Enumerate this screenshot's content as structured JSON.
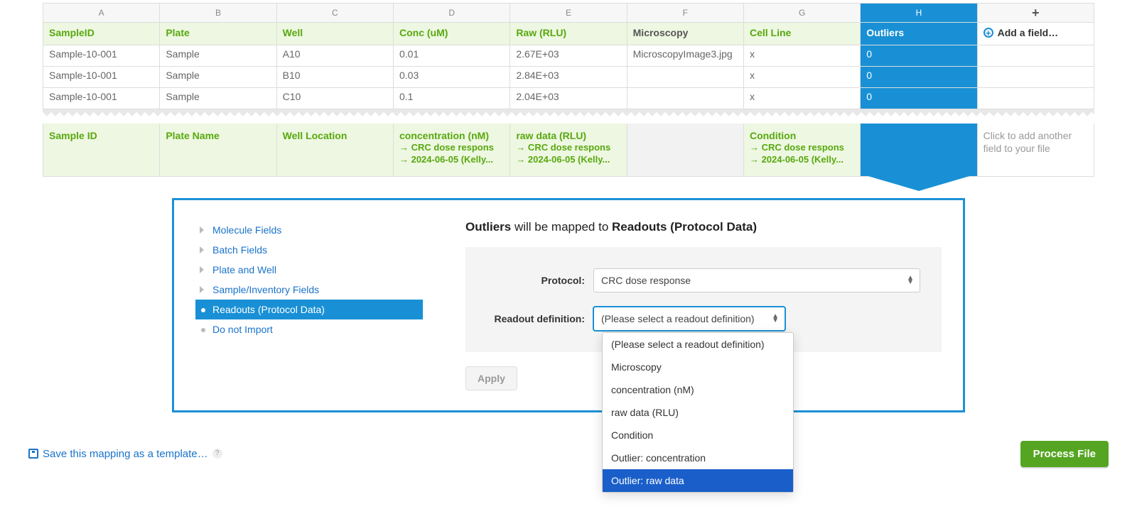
{
  "columns": {
    "letters": [
      "A",
      "B",
      "C",
      "D",
      "E",
      "F",
      "G",
      "H",
      "+"
    ],
    "headers": [
      "SampleID",
      "Plate",
      "Well",
      "Conc (uM)",
      "Raw (RLU)",
      "Microscopy",
      "Cell Line",
      "Outliers"
    ],
    "add_field": "Add a field…",
    "selected_index": 7
  },
  "rows": [
    [
      "Sample-10-001",
      "Sample",
      "A10",
      "0.01",
      "2.67E+03",
      "MicroscopyImage3.jpg",
      "x",
      "0"
    ],
    [
      "Sample-10-001",
      "Sample",
      "B10",
      "0.03",
      "2.84E+03",
      "",
      "x",
      "0"
    ],
    [
      "Sample-10-001",
      "Sample",
      "C10",
      "0.1",
      "2.04E+03",
      "",
      "x",
      "0"
    ]
  ],
  "mappings": [
    {
      "type": "mapped",
      "title": "Sample ID"
    },
    {
      "type": "mapped",
      "title": "Plate Name"
    },
    {
      "type": "mapped",
      "title": "Well Location"
    },
    {
      "type": "mapped",
      "title": "concentration (nM)",
      "sub1": "→ CRC dose respons",
      "sub2": "→ 2024-06-05 (Kelly..."
    },
    {
      "type": "mapped",
      "title": "raw data (RLU)",
      "sub1": "→ CRC dose respons",
      "sub2": "→ 2024-06-05 (Kelly..."
    },
    {
      "type": "grey"
    },
    {
      "type": "mapped",
      "title": "Condition",
      "sub1": "→ CRC dose respons",
      "sub2": "→ 2024-06-05 (Kelly..."
    },
    {
      "type": "selected"
    },
    {
      "type": "hint",
      "hint": "Click to add another field to your file"
    }
  ],
  "panel": {
    "categories": [
      "Molecule Fields",
      "Batch Fields",
      "Plate and Well",
      "Sample/Inventory Fields",
      "Readouts (Protocol Data)",
      "Do not Import"
    ],
    "selected_category_index": 4,
    "heading_field": "Outliers",
    "heading_mid": " will be mapped to ",
    "heading_target": "Readouts (Protocol Data)",
    "protocol_label": "Protocol:",
    "protocol_value": "CRC dose response",
    "readout_label": "Readout definition:",
    "readout_value": "(Please select a readout definition)",
    "apply": "Apply",
    "options": [
      "(Please select a readout definition)",
      "Microscopy",
      "concentration (nM)",
      "raw data (RLU)",
      "Condition",
      "Outlier: concentration",
      "Outlier: raw data"
    ],
    "highlighted_option_index": 6
  },
  "footer": {
    "save": "Save this mapping as a template…",
    "help": "?",
    "process": "Process File"
  }
}
